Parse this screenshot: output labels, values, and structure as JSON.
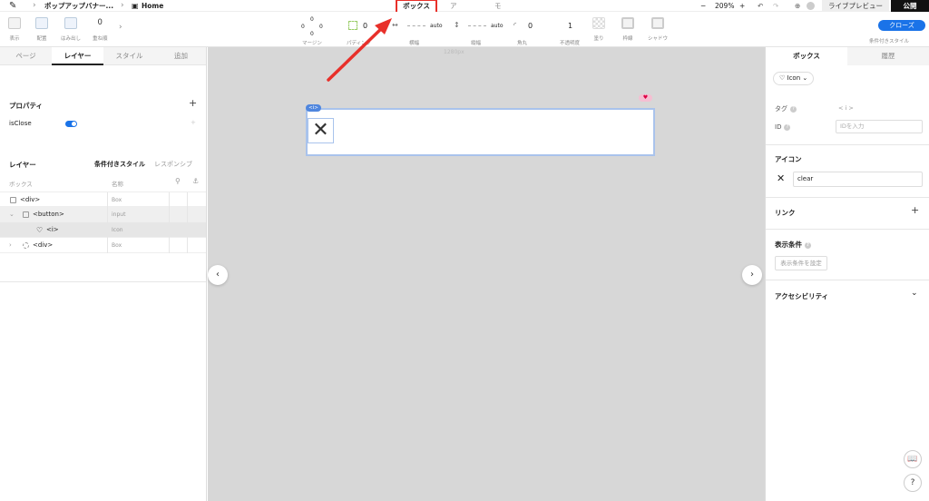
{
  "topbar": {
    "project": "ポップアップバナー...",
    "page": "Home",
    "tabs": {
      "box": "ボックス",
      "icon": "アイコン",
      "motion": "モーション"
    },
    "zoom": "209%",
    "zoom_minus": "−",
    "zoom_plus": "+",
    "preview": "ライブプレビュー",
    "publish": "公開"
  },
  "toolbar": {
    "display": "表示",
    "align": "配置",
    "overflow": "はみ出し",
    "z_value": "0",
    "z_label": "重ね順",
    "margin": "マージン",
    "margin_top": "0",
    "margin_left": "0",
    "margin_right": "0",
    "margin_bottom": "0",
    "padding": "パディング",
    "padding_value": "0",
    "width_label": "横幅",
    "width_value": "auto",
    "height_label": "縦幅",
    "height_value": "auto",
    "radius_value": "0",
    "radius_label": "角丸",
    "opacity_value": "1",
    "opacity_label": "不透明度",
    "fill_label": "塗り",
    "border_label": "枠線",
    "shadow_label": "シャドウ",
    "close_button": "クローズ",
    "conditional_style": "条件付きスタイル"
  },
  "left": {
    "tabs": [
      "ページ",
      "レイヤー",
      "スタイル",
      "追加"
    ],
    "properties_title": "プロパティ",
    "prop_name": "isClose",
    "layer_title": "レイヤー",
    "conditional_style": "条件付きスタイル",
    "responsive": "レスポンシブ",
    "col_box": "ボックス",
    "col_name": "名称",
    "rows": [
      {
        "name": "<div>",
        "type": "Box"
      },
      {
        "name": "<button>",
        "type": "input"
      },
      {
        "name": "<i>",
        "type": "Icon"
      },
      {
        "name": "<div>",
        "type": "Box"
      }
    ]
  },
  "canvas": {
    "ruler": "1280px",
    "tag": "<i>",
    "icon_glyph": "✕"
  },
  "right": {
    "tabs": [
      "ボックス",
      "履歴"
    ],
    "chip": "Icon",
    "tag_label": "タグ",
    "tag_value": "< i >",
    "id_label": "ID",
    "id_placeholder": "IDを入力",
    "icon_section": "アイコン",
    "icon_name": "clear",
    "link_section": "リンク",
    "condition_section": "表示条件",
    "condition_button": "表示条件を設定",
    "a11y_section": "アクセシビリティ",
    "help": "?"
  },
  "colors": {
    "accent": "#1a73e8",
    "highlight": "#e8302a",
    "canvas": "#d7d7d7"
  }
}
